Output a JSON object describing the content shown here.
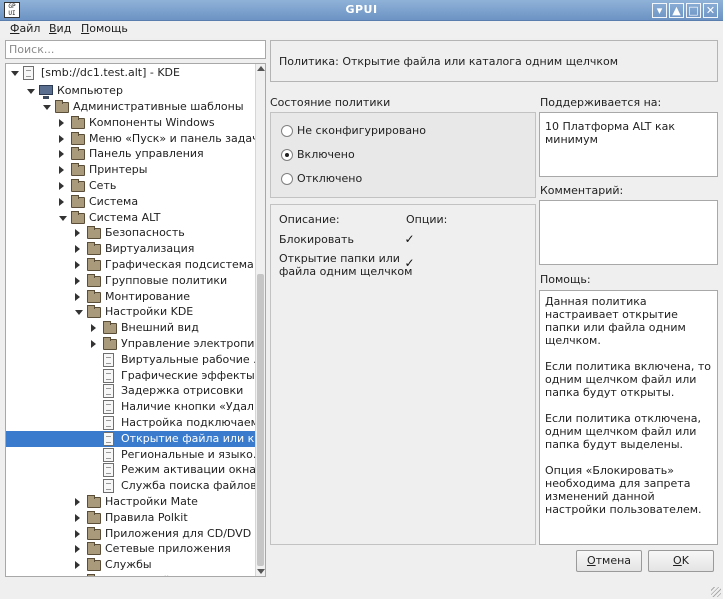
{
  "window": {
    "title": "GPUI",
    "icon_text": "GP UI",
    "buttons": [
      "▾",
      "▲",
      "□",
      "✕"
    ]
  },
  "menu": [
    {
      "label": "Файл",
      "mnemonic": "Ф",
      "rest": "айл"
    },
    {
      "label": "Вид",
      "mnemonic": "В",
      "rest": "ид"
    },
    {
      "label": "Помощь",
      "mnemonic": "П",
      "rest": "омощь"
    }
  ],
  "search": {
    "placeholder": "Поиск...",
    "value": ""
  },
  "tree": [
    {
      "label": "[smb://dc1.test.alt] - KDE",
      "depth": 0,
      "arrow": "down",
      "icon": "doc"
    },
    {
      "label": "Компьютер",
      "depth": 1,
      "arrow": "down",
      "icon": "computer"
    },
    {
      "label": "Административные шаблоны",
      "depth": 2,
      "arrow": "down",
      "icon": "folder"
    },
    {
      "label": "Компоненты Windows",
      "depth": 3,
      "arrow": "right",
      "icon": "folder"
    },
    {
      "label": "Меню «Пуск» и панель задач",
      "depth": 3,
      "arrow": "right",
      "icon": "folder"
    },
    {
      "label": "Панель управления",
      "depth": 3,
      "arrow": "right",
      "icon": "folder"
    },
    {
      "label": "Принтеры",
      "depth": 3,
      "arrow": "right",
      "icon": "folder"
    },
    {
      "label": "Сеть",
      "depth": 3,
      "arrow": "right",
      "icon": "folder"
    },
    {
      "label": "Система",
      "depth": 3,
      "arrow": "right",
      "icon": "folder"
    },
    {
      "label": "Система ALT",
      "depth": 3,
      "arrow": "down",
      "icon": "folder"
    },
    {
      "label": "Безопасность",
      "depth": 4,
      "arrow": "right",
      "icon": "folder"
    },
    {
      "label": "Виртуализация",
      "depth": 4,
      "arrow": "right",
      "icon": "folder"
    },
    {
      "label": "Графическая подсистема",
      "depth": 4,
      "arrow": "right",
      "icon": "folder"
    },
    {
      "label": "Групповые политики",
      "depth": 4,
      "arrow": "right",
      "icon": "folder"
    },
    {
      "label": "Монтирование",
      "depth": 4,
      "arrow": "right",
      "icon": "folder"
    },
    {
      "label": "Настройки KDE",
      "depth": 4,
      "arrow": "down",
      "icon": "folder"
    },
    {
      "label": "Внешний вид",
      "depth": 5,
      "arrow": "right",
      "icon": "folder"
    },
    {
      "label": "Управление электропи...",
      "depth": 5,
      "arrow": "right",
      "icon": "folder"
    },
    {
      "label": "Виртуальные рабочие ...",
      "depth": 5,
      "arrow": "",
      "icon": "doc"
    },
    {
      "label": "Графические эффекты",
      "depth": 5,
      "arrow": "",
      "icon": "doc"
    },
    {
      "label": "Задержка отрисовки",
      "depth": 5,
      "arrow": "",
      "icon": "doc"
    },
    {
      "label": "Наличие кнопки «Удал...",
      "depth": 5,
      "arrow": "",
      "icon": "doc"
    },
    {
      "label": "Настройка подключаем...",
      "depth": 5,
      "arrow": "",
      "icon": "doc"
    },
    {
      "label": "Открытие файла или к...",
      "depth": 5,
      "arrow": "",
      "icon": "doc",
      "selected": true
    },
    {
      "label": "Региональные и языко...",
      "depth": 5,
      "arrow": "",
      "icon": "doc"
    },
    {
      "label": "Режим активации окна",
      "depth": 5,
      "arrow": "",
      "icon": "doc"
    },
    {
      "label": "Служба поиска файлов",
      "depth": 5,
      "arrow": "",
      "icon": "doc"
    },
    {
      "label": "Настройки Mate",
      "depth": 4,
      "arrow": "right",
      "icon": "folder"
    },
    {
      "label": "Правила Polkit",
      "depth": 4,
      "arrow": "right",
      "icon": "folder"
    },
    {
      "label": "Приложения для CD/DVD",
      "depth": 4,
      "arrow": "right",
      "icon": "folder"
    },
    {
      "label": "Сетевые приложения",
      "depth": 4,
      "arrow": "right",
      "icon": "folder"
    },
    {
      "label": "Службы",
      "depth": 4,
      "arrow": "right",
      "icon": "folder"
    },
    {
      "label": "Удаленный доступ через V...",
      "depth": 4,
      "arrow": "right",
      "icon": "folder"
    }
  ],
  "policy": {
    "title": "Политика: Открытие файла или каталога одним щелчком"
  },
  "state": {
    "label": "Состояние политики",
    "options": [
      {
        "label": "Не сконфигурировано",
        "checked": false
      },
      {
        "label": "Включено",
        "checked": true
      },
      {
        "label": "Отключено",
        "checked": false
      }
    ]
  },
  "options_panel": {
    "description_header": "Описание:",
    "options_header": "Опции:",
    "items": [
      {
        "label": "Блокировать",
        "checked": true
      },
      {
        "label": "Открытие папки или\nфайла одним щелчком",
        "checked": true
      }
    ]
  },
  "supported": {
    "label": "Поддерживается на:",
    "value": "10 Платформа ALT как минимум"
  },
  "comment": {
    "label": "Комментарий:",
    "value": ""
  },
  "help": {
    "label": "Помощь:",
    "text": "Данная политика настраивает открытие папки или файла одним щелчком.\n\nЕсли политика включена, то одним щелчком файл или папка будут открыты.\n\nЕсли политика отключена, одним щелчком файл или папка будут выделены.\n\nОпция «Блокировать» необходима для запрета изменений данной настройки пользователем."
  },
  "buttons": {
    "cancel": {
      "mnemonic": "О",
      "rest": "тмена"
    },
    "ok": {
      "mnemonic": "O",
      "rest": "K"
    }
  },
  "colors": {
    "selection": "#3a7bcd",
    "titlebar": "#7a9fcd"
  }
}
